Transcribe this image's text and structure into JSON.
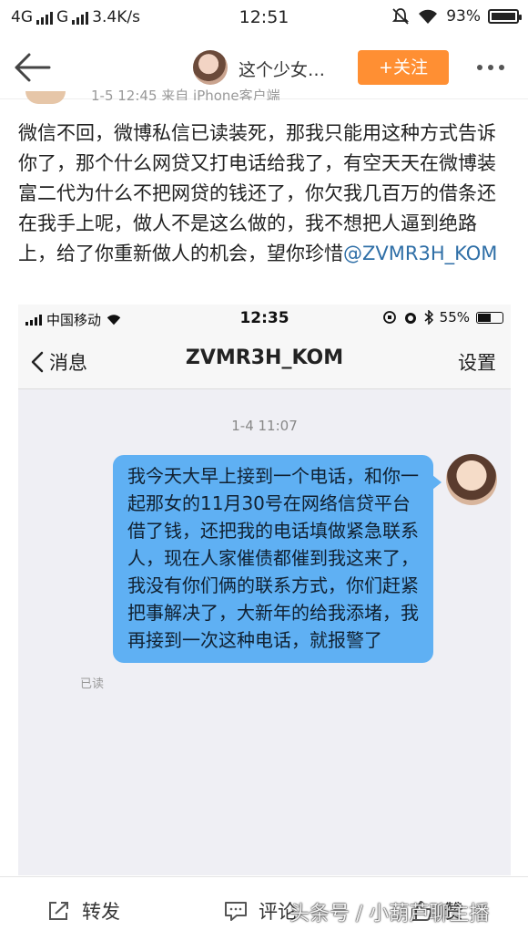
{
  "status_bar": {
    "network1": "4G",
    "network2": "G",
    "speed": "3.4K/s",
    "time": "12:51",
    "battery": "93%"
  },
  "header": {
    "back_icon": "arrow-left-icon",
    "title": "这个少女…",
    "follow_label": "+关注",
    "more_icon": "more-horizontal-icon"
  },
  "post": {
    "meta": "1-5 12:45 来自 iPhone客户端",
    "text": "微信不回，微博私信已读装死，那我只能用这种方式告诉你了，那个什么网贷又打电话给我了，有空天天在微博装富二代为什么不把网贷的钱还了，你欠我几百万的借条还在我手上呢，做人不是这么做的，我不想把人逼到绝路上，给了你重新做人的机会，望你珍惜",
    "mention": "@ZVMR3H_KOM"
  },
  "embedded": {
    "carrier": "中国移动",
    "time": "12:35",
    "battery": "55%",
    "back_label": "消息",
    "title": "ZVMR3H_KOM",
    "settings_label": "设置",
    "timestamp": "1-4 11:07",
    "message": "我今天大早上接到一个电话，和你一起那女的11月30号在网络信贷平台借了钱，还把我的电话填做紧急联系人，现在人家催债都催到我这来了，我没有你们俩的联系方式，你们赶紧把事解决了，大新年的给我添堵，我再接到一次这种电话，就报警了",
    "read_label": "已读"
  },
  "bottom_bar": {
    "repost_label": "转发",
    "comment_label": "评论",
    "like_label": "赞",
    "watermark": "头条号 / 小葫芦聊主播"
  }
}
